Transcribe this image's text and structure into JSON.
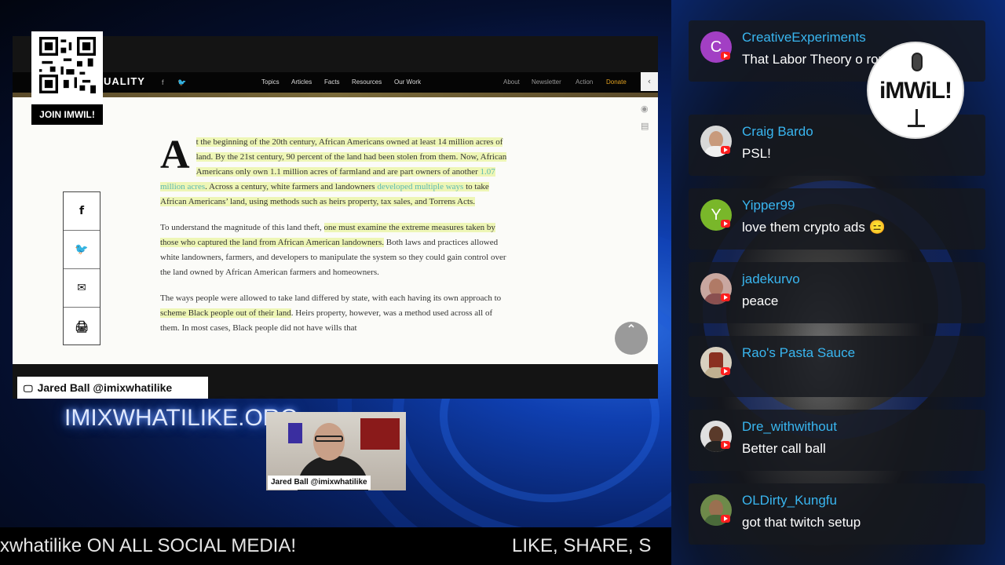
{
  "qr": {
    "join_label": "JOIN IMWIL!"
  },
  "website": {
    "logo": "UALITY",
    "nav": [
      "Topics",
      "Articles",
      "Facts",
      "Resources",
      "Our Work"
    ],
    "nav_right": [
      "About",
      "Newsletter",
      "Action"
    ],
    "donate": "Donate",
    "share_buttons": [
      "f",
      "🐦",
      "✉",
      "🖨"
    ],
    "article": {
      "drop_cap": "A",
      "p1_a": "t the beginning of the 20th century, African Americans owned at least 14 million acres of land. By the 21st century, 90 percent of the land had been stolen from them. Now, African Americans only own 1.1 million acres of farmland and are part owners of another ",
      "p1_link1": "1.07 million acres",
      "p1_b": ". Across a century, white farmers and landowners ",
      "p1_link2": "developed multiple ways",
      "p1_c": " to take African Americans’ land, using methods such as heirs property, tax sales, and Torrens Acts.",
      "p2_a": "To understand the magnitude of this land theft, ",
      "p2_hl": "one must examine the extreme measures taken by those who captured the land from African American landowners.",
      "p2_b": " Both laws and practices allowed white landowners, farmers, and developers to manipulate the system so they could gain control over the land owned by African American farmers and homeowners.",
      "p3_a": "The ways people were allowed to take land differed by state, with each having its own approach to ",
      "p3_hl": "scheme Black people out of their land",
      "p3_b": ". Heirs property, however, was a method used across all of them. In most cases, Black people did not have wills that"
    }
  },
  "overlay": {
    "name_tag": "Jared Ball @imixwhatilike",
    "site_url": "IMIXWHATILIKE.ORG",
    "cam_label": "Jared Ball @imixwhatilike",
    "ticker_left": "xwhatilike ON ALL SOCIAL MEDIA!",
    "ticker_right": "LIKE, SHARE, S"
  },
  "logo": {
    "text": "iMWiL!"
  },
  "chat": [
    {
      "user": "CreativeExperiments",
      "text": "That Labor Theory o rough",
      "avatar_letter": "C",
      "avatar_color": "#a23fc4"
    },
    {
      "user": "Craig Bardo",
      "text": "PSL!",
      "avatar_letter": "",
      "avatar_color": "#d8d8d8"
    },
    {
      "user": "Yipper99",
      "text": "love them crypto ads 😑",
      "avatar_letter": "Y",
      "avatar_color": "#79b72a"
    },
    {
      "user": "jadekurvo",
      "text": "peace",
      "avatar_letter": "",
      "avatar_color": "#c9a7a0"
    },
    {
      "user": "Rao's Pasta Sauce",
      "text": "",
      "avatar_letter": "",
      "avatar_color": "#d8d0c0"
    },
    {
      "user": "Dre_withwithout",
      "text": "Better call ball",
      "avatar_letter": "",
      "avatar_color": "#e0e0e0"
    },
    {
      "user": "OLDirty_Kungfu",
      "text": "got that twitch setup",
      "avatar_letter": "",
      "avatar_color": "#6e8a4a"
    }
  ]
}
